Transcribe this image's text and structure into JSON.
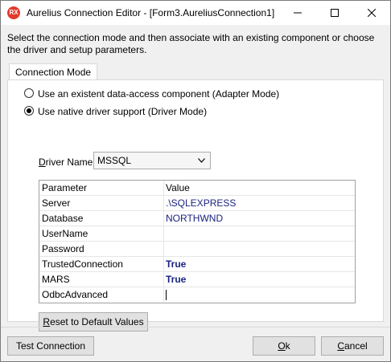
{
  "window": {
    "icon_text": "RX",
    "title": "Aurelius Connection Editor - [Form3.AureliusConnection1]"
  },
  "instructions": "Select the connection mode and then associate with an existing component or choose the driver and setup parameters.",
  "tab": {
    "label": "Connection Mode"
  },
  "modes": [
    {
      "label": "Use an existent data-access component (Adapter Mode)",
      "selected": false
    },
    {
      "label": "Use native driver support (Driver Mode)",
      "selected": true
    }
  ],
  "driver": {
    "label_prefix": "D",
    "label_rest": "river Name:",
    "selected": "MSSQL"
  },
  "grid": {
    "headers": {
      "name": "Parameter",
      "value": "Value"
    },
    "rows": [
      {
        "name": "Server",
        "value": ".\\SQLEXPRESS"
      },
      {
        "name": "Database",
        "value": "NORTHWND"
      },
      {
        "name": "UserName",
        "value": ""
      },
      {
        "name": "Password",
        "value": ""
      },
      {
        "name": "TrustedConnection",
        "value": "True"
      },
      {
        "name": "MARS",
        "value": "True"
      },
      {
        "name": "OdbcAdvanced",
        "value": ""
      }
    ]
  },
  "buttons": {
    "reset_prefix": "R",
    "reset_rest": "eset to Default Values",
    "test": "Test Connection",
    "ok_prefix": "O",
    "ok_rest": "k",
    "cancel_prefix": "C",
    "cancel_rest": "ancel"
  }
}
